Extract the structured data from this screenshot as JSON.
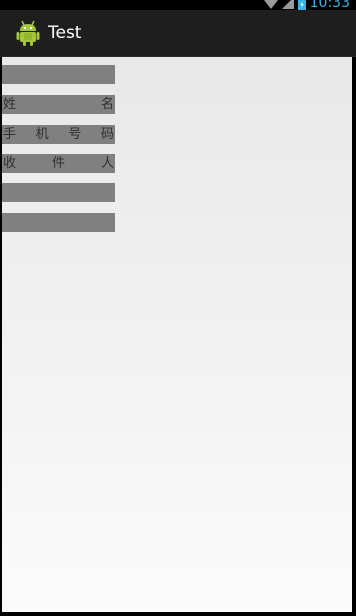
{
  "status_bar": {
    "time": "10:33",
    "icons": [
      "wifi-icon",
      "signal-icon",
      "battery-icon"
    ],
    "clock_color": "#33b5e5"
  },
  "action_bar": {
    "title": "Test",
    "icon": "android-icon",
    "background": "#1e1e1e"
  },
  "form": {
    "fields": [
      {
        "label_chars": []
      },
      {
        "label_chars": [
          "姓",
          "名"
        ]
      },
      {
        "label_chars": [
          "手",
          "机",
          "号",
          "码"
        ]
      },
      {
        "label_chars": [
          "收",
          "件",
          "人"
        ]
      },
      {
        "label_chars": []
      },
      {
        "label_chars": []
      }
    ],
    "field_color": "#808080"
  }
}
